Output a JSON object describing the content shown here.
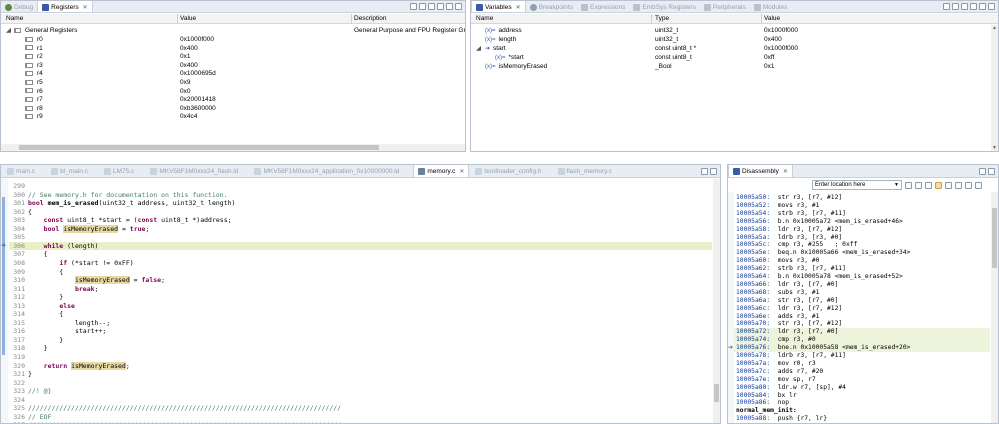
{
  "registers_view": {
    "tabs": [
      {
        "label": "Debug",
        "active": false
      },
      {
        "label": "Registers",
        "active": true
      }
    ],
    "columns": [
      "Name",
      "Value",
      "Description"
    ],
    "group": {
      "name": "General Registers",
      "description": "General Purpose and FPU Register Gro"
    },
    "rows": [
      {
        "name": "r0",
        "value": "0x1000f000"
      },
      {
        "name": "r1",
        "value": "0x400"
      },
      {
        "name": "r2",
        "value": "0x1"
      },
      {
        "name": "r3",
        "value": "0x400"
      },
      {
        "name": "r4",
        "value": "0x1000695d"
      },
      {
        "name": "r5",
        "value": "0x9"
      },
      {
        "name": "r6",
        "value": "0x0"
      },
      {
        "name": "r7",
        "value": "0x20001418"
      },
      {
        "name": "r8",
        "value": "0xb3600000"
      },
      {
        "name": "r9",
        "value": "0x4c4"
      }
    ]
  },
  "variables_view": {
    "tabs": [
      {
        "label": "Variables",
        "active": true
      },
      {
        "label": "Breakpoints",
        "active": false
      },
      {
        "label": "Expressions",
        "active": false
      },
      {
        "label": "EmbSys Registers",
        "active": false
      },
      {
        "label": "Peripherals",
        "active": false
      },
      {
        "label": "Modules",
        "active": false
      }
    ],
    "columns": [
      "Name",
      "Type",
      "Value"
    ],
    "rows": [
      {
        "name": "address",
        "type": "uint32_t",
        "value": "0x1000f000",
        "indent": 0,
        "icon": "(x)="
      },
      {
        "name": "length",
        "type": "uint32_t",
        "value": "0x400",
        "indent": 0,
        "icon": "(x)="
      },
      {
        "name": "start",
        "type": "const uint8_t *",
        "value": "0x1000f000",
        "indent": 0,
        "icon": "➜"
      },
      {
        "name": "*start",
        "type": "const uint8_t",
        "value": "0xff",
        "indent": 1,
        "icon": "(x)="
      },
      {
        "name": "isMemoryErased",
        "type": "_Bool",
        "value": "0x1",
        "indent": 0,
        "icon": "(x)="
      }
    ]
  },
  "editor": {
    "tabs": [
      {
        "label": "main.c",
        "active": false
      },
      {
        "label": "bl_main.c",
        "active": false
      },
      {
        "label": "LM75.c",
        "active": false
      },
      {
        "label": "MKV58F1M0xxx24_flash.ld",
        "active": false
      },
      {
        "label": "MKV58F1M0xxx24_application_0x10000000.ld",
        "active": false
      },
      {
        "label": "memory.c",
        "active": true
      },
      {
        "label": "bootloader_config.h",
        "active": false
      },
      {
        "label": "flash_memory.c",
        "active": false
      }
    ],
    "lines": [
      {
        "n": "299",
        "t": ""
      },
      {
        "n": "300",
        "t": "// See memory.h for documentation on this function."
      },
      {
        "n": "301",
        "t": "bool mem_is_erased(uint32_t address, uint32_t length)"
      },
      {
        "n": "302",
        "t": "{"
      },
      {
        "n": "303",
        "t": "    const uint8_t *start = (const uint8_t *)address;"
      },
      {
        "n": "304",
        "t": "    bool isMemoryErased = true;"
      },
      {
        "n": "305",
        "t": ""
      },
      {
        "n": "306",
        "t": "    while (length)"
      },
      {
        "n": "307",
        "t": "    {"
      },
      {
        "n": "308",
        "t": "        if (*start != 0xFF)"
      },
      {
        "n": "309",
        "t": "        {"
      },
      {
        "n": "310",
        "t": "            isMemoryErased = false;"
      },
      {
        "n": "311",
        "t": "            break;"
      },
      {
        "n": "312",
        "t": "        }"
      },
      {
        "n": "313",
        "t": "        else"
      },
      {
        "n": "314",
        "t": "        {"
      },
      {
        "n": "315",
        "t": "            length--;"
      },
      {
        "n": "316",
        "t": "            start++;"
      },
      {
        "n": "317",
        "t": "        }"
      },
      {
        "n": "318",
        "t": "    }"
      },
      {
        "n": "319",
        "t": ""
      },
      {
        "n": "320",
        "t": "    return isMemoryErased;"
      },
      {
        "n": "321",
        "t": "}"
      },
      {
        "n": "322",
        "t": ""
      },
      {
        "n": "323",
        "t": "//! @}"
      },
      {
        "n": "324",
        "t": ""
      },
      {
        "n": "325",
        "t": "////////////////////////////////////////////////////////////////////////////////"
      },
      {
        "n": "326",
        "t": "// EOF"
      },
      {
        "n": "327",
        "t": "////////////////////////////////////////////////////////////////////////////////"
      },
      {
        "n": "328",
        "t": ""
      }
    ]
  },
  "disassembly": {
    "tab": "Disassembly",
    "location_placeholder": "Enter location here",
    "lines": [
      {
        "a": "10005a50:",
        "i": "str r3, [r7, #12]"
      },
      {
        "a": "10005a52:",
        "i": "movs r3, #1"
      },
      {
        "a": "10005a54:",
        "i": "strb r3, [r7, #11]"
      },
      {
        "a": "10005a56:",
        "i": "b.n 0x10005a72 <mem_is_erased+46>"
      },
      {
        "a": "10005a58:",
        "i": "ldr r3, [r7, #12]"
      },
      {
        "a": "10005a5a:",
        "i": "ldrb r3, [r3, #0]"
      },
      {
        "a": "10005a5c:",
        "i": "cmp r3, #255   ; 0xff"
      },
      {
        "a": "10005a5e:",
        "i": "beq.n 0x10005a66 <mem_is_erased+34>"
      },
      {
        "a": "10005a60:",
        "i": "movs r3, #0"
      },
      {
        "a": "10005a62:",
        "i": "strb r3, [r7, #11]"
      },
      {
        "a": "10005a64:",
        "i": "b.n 0x10005a78 <mem_is_erased+52>"
      },
      {
        "a": "10005a66:",
        "i": "ldr r3, [r7, #0]"
      },
      {
        "a": "10005a68:",
        "i": "subs r3, #1"
      },
      {
        "a": "10005a6a:",
        "i": "str r3, [r7, #0]"
      },
      {
        "a": "10005a6c:",
        "i": "ldr r3, [r7, #12]"
      },
      {
        "a": "10005a6e:",
        "i": "adds r3, #1"
      },
      {
        "a": "10005a70:",
        "i": "str r3, [r7, #12]"
      },
      {
        "a": "10005a72:",
        "i": "ldr r3, [r7, #0]"
      },
      {
        "a": "10005a74:",
        "i": "cmp r3, #0"
      },
      {
        "a": "10005a76:",
        "i": "bne.n 0x10005a58 <mem_is_erased+20>"
      },
      {
        "a": "10005a78:",
        "i": "ldrb r3, [r7, #11]"
      },
      {
        "a": "10005a7a:",
        "i": "mov r0, r3"
      },
      {
        "a": "10005a7c:",
        "i": "adds r7, #20"
      },
      {
        "a": "10005a7e:",
        "i": "mov sp, r7"
      },
      {
        "a": "10005a80:",
        "i": "ldr.w r7, [sp], #4"
      },
      {
        "a": "10005a84:",
        "i": "bx lr"
      },
      {
        "a": "10005a86:",
        "i": "nop"
      },
      {
        "a": "",
        "i": "normal_mem_init:"
      },
      {
        "a": "10005a88:",
        "i": "push {r7, lr}"
      }
    ]
  },
  "colors": {
    "accent": "#3b5aa3",
    "current_line": "#e8f0c8",
    "comment": "#3f7f5f",
    "keyword": "#7f0055"
  }
}
